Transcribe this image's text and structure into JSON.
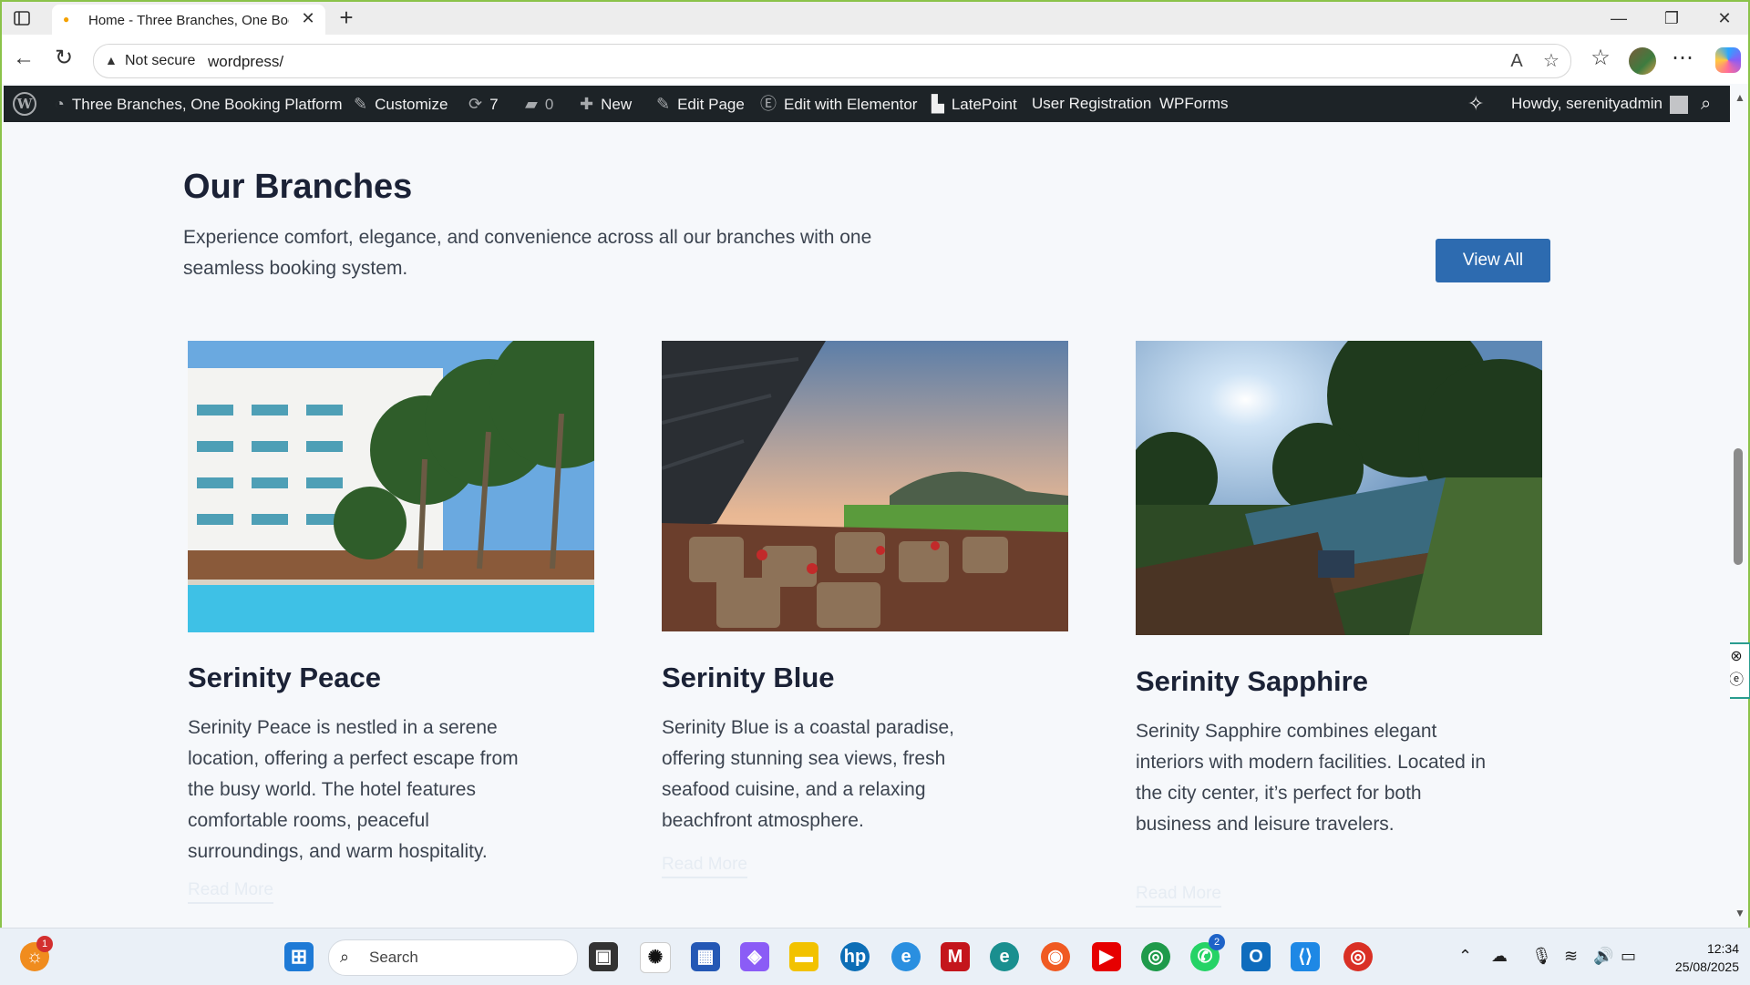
{
  "browser": {
    "tab_title": "Home - Three Branches, One Boo",
    "new_tab": "+",
    "security_label": "Not secure",
    "url": "wordpress/",
    "icons": [
      "sidebar-icon",
      "back-icon",
      "refresh-icon",
      "read-aloud-icon",
      "favorite-star-icon",
      "favorites-icon",
      "profile-avatar",
      "more-icon",
      "copilot-icon"
    ]
  },
  "wp_admin_bar": {
    "site_name": "Three Branches, One Booking Platform",
    "customize": "Customize",
    "updates_count": "7",
    "comments_count": "0",
    "new": "New",
    "edit_page": "Edit Page",
    "edit_elementor": "Edit with Elementor",
    "latepoint": "LatePoint",
    "user_registration": "User Registration",
    "wpforms": "WPForms",
    "howdy": "Howdy, serenityadmin"
  },
  "section": {
    "title": "Our Branches",
    "description": "Experience comfort, elegance, and convenience across all our branches with one seamless booking system.",
    "view_all": "View All"
  },
  "branches": [
    {
      "name": "Serinity Peace",
      "description": "Serinity Peace is nestled in a serene location, offering a perfect escape from the busy world. The hotel features comfortable rooms, peaceful surroundings, and warm hospitality.",
      "link": "Read More",
      "image": "hotel-pool-palms-image"
    },
    {
      "name": "Serinity Blue",
      "description": "Serinity Blue is a coastal paradise, offering stunning sea views, fresh seafood cuisine, and a relaxing beachfront atmosphere.",
      "link": "Read More",
      "image": "terrace-restaurant-sunset-image"
    },
    {
      "name": "Serinity Sapphire",
      "description": "Serinity Sapphire combines elegant interiors with modern facilities. Located in the city center, it’s perfect for both business and leisure travelers.",
      "link": "Read More",
      "image": "infinity-pool-forest-image"
    }
  ],
  "taskbar": {
    "search_label": "Search",
    "notification_badge": "1",
    "whatsapp_badge": "2",
    "time": "12:34",
    "date": "25/08/2025"
  },
  "colors": {
    "accent": "#2d6bb0",
    "admin_bar": "#1d2327",
    "page_bg": "#f6f8fb",
    "heading": "#1b2236"
  }
}
